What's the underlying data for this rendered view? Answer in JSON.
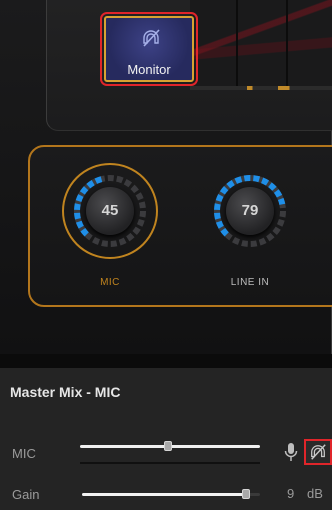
{
  "monitor_button": {
    "label": "Monitor",
    "icon": "monitor-off-icon"
  },
  "knobs": [
    {
      "value": "45",
      "label": "MIC",
      "level": 0.45,
      "accent": "#c0841f"
    },
    {
      "value": "79",
      "label": "LINE IN",
      "level": 0.79
    }
  ],
  "master_mix": {
    "title": "Master Mix - MIC",
    "mic_row": {
      "label": "MIC",
      "level": 0.49,
      "mic_icon": "microphone-icon",
      "monitor_icon": "monitor-off-icon"
    },
    "gain_row": {
      "label": "Gain",
      "value": "9",
      "unit": "dB",
      "level": 0.92
    }
  },
  "colors": {
    "accent": "#c0841f",
    "knob_arc": "#1f8fe8",
    "highlight": "#e0252a",
    "monitor_bg": "#262a5e"
  }
}
